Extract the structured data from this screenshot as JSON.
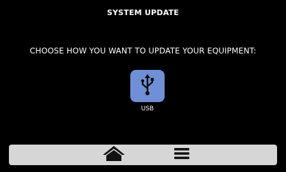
{
  "screen": {
    "title": "SYSTEM UPDATE",
    "prompt": "CHOOSE HOW YOU WANT TO UPDATE YOUR EQUIPMENT:"
  },
  "options": [
    {
      "label": "USB",
      "icon": "usb-icon",
      "color": "#6f8fd6"
    }
  ],
  "bottom_bar": {
    "buttons": [
      {
        "icon": "home-icon"
      },
      {
        "icon": "menu-icon"
      }
    ]
  },
  "colors": {
    "background": "#000000",
    "text": "#ffffff",
    "bar": "#d6d6d6",
    "bar_icon": "#111111"
  }
}
